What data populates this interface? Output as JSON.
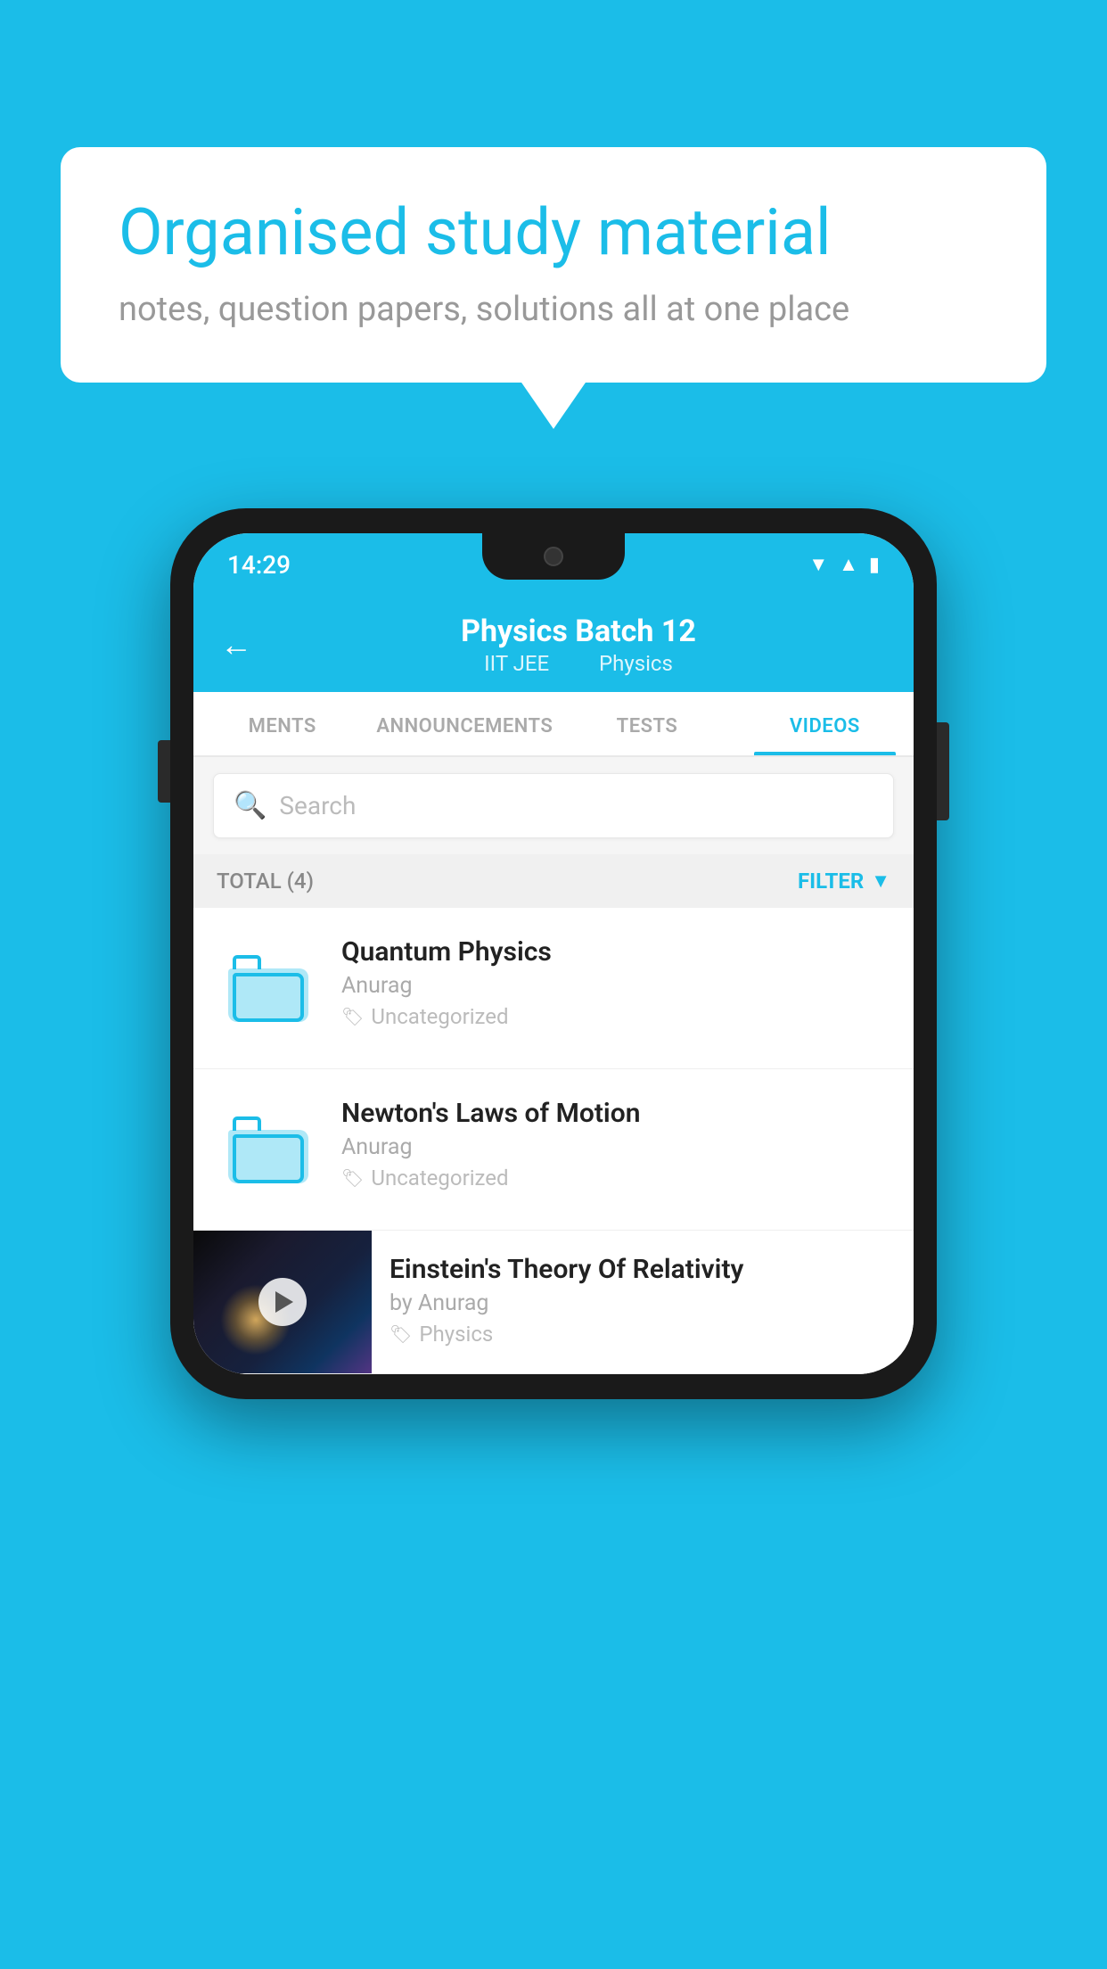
{
  "background_color": "#1BBDE8",
  "speech_bubble": {
    "heading": "Organised study material",
    "subtext": "notes, question papers, solutions all at one place"
  },
  "status_bar": {
    "time": "14:29",
    "wifi_icon": "▼",
    "signal_icon": "▲",
    "battery_icon": "▮"
  },
  "app_header": {
    "back_label": "←",
    "title": "Physics Batch 12",
    "subtitle_part1": "IIT JEE",
    "subtitle_part2": "Physics"
  },
  "tabs": [
    {
      "label": "MENTS",
      "active": false
    },
    {
      "label": "ANNOUNCEMENTS",
      "active": false
    },
    {
      "label": "TESTS",
      "active": false
    },
    {
      "label": "VIDEOS",
      "active": true
    }
  ],
  "search": {
    "placeholder": "Search"
  },
  "filter_bar": {
    "total_label": "TOTAL (4)",
    "filter_label": "FILTER"
  },
  "videos": [
    {
      "title": "Quantum Physics",
      "author": "Anurag",
      "tag": "Uncategorized",
      "has_thumbnail": false
    },
    {
      "title": "Newton's Laws of Motion",
      "author": "Anurag",
      "tag": "Uncategorized",
      "has_thumbnail": false
    },
    {
      "title": "Einstein's Theory Of Relativity",
      "author": "by Anurag",
      "tag": "Physics",
      "has_thumbnail": true
    }
  ]
}
